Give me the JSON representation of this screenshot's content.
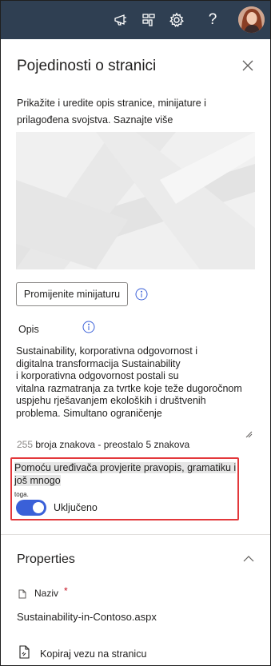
{
  "topbar": {
    "icons": [
      "megaphone-icon",
      "app-launcher-icon",
      "gear-icon",
      "help-icon",
      "avatar"
    ],
    "help_glyph": "?"
  },
  "panel": {
    "title": "Pojedinosti o stranici",
    "intro": "Prikažite i uredite opis stranice, minijature i prilagođena svojstva.",
    "learn_more": "Saznajte više",
    "change_thumbnail_label": "Promijenite minijaturu",
    "description_label": "Opis",
    "description_value": "Sustainability, korporativna odgovornost i\ndigitalna transformacija Sustainability\ni korporativna odgovornost postali su\nvitalna razmatranja za tvrtke koje teže dugoročnom\nuspjehu rješavanjem ekoloških i društvenih\nproblema. Simultano ograničenje",
    "char_count": "255",
    "char_count_text": "broja znakova - preostalo 5 znakova",
    "spellcheck_text": "Pomoću uređivača provjerite pravopis, gramatiku i još mnogo",
    "spellcheck_text_small": "toga.",
    "toggle_label": "Uključeno",
    "toggle_on": true
  },
  "properties": {
    "title": "Properties",
    "name_label": "Naziv",
    "required_marker": "*",
    "file_name": "Sustainability-in-Contoso.aspx",
    "copy_link_label": "Kopiraj vezu na stranicu"
  },
  "colors": {
    "topbar": "#2f3f52",
    "toggle": "#3a60d8",
    "highlight_border": "#e3383b",
    "required": "#c50f1f"
  }
}
